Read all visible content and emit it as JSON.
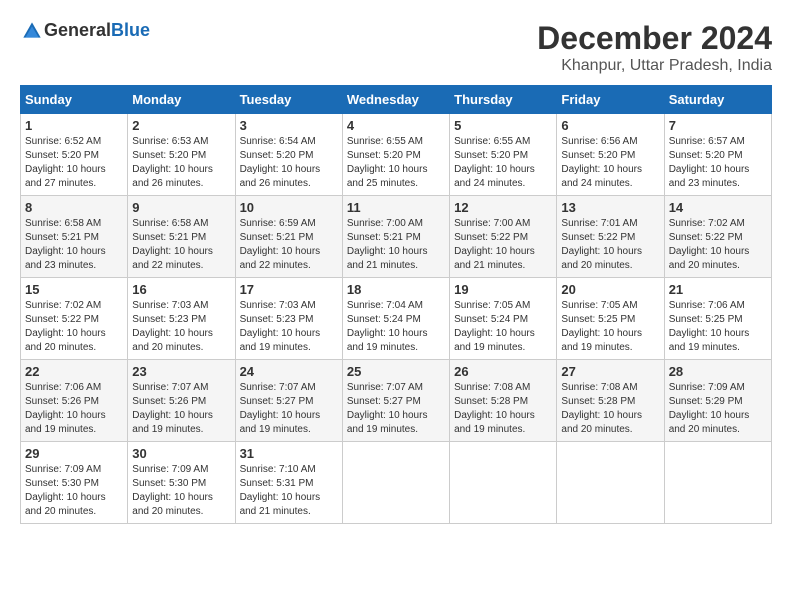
{
  "logo": {
    "text_general": "General",
    "text_blue": "Blue"
  },
  "title": "December 2024",
  "subtitle": "Khanpur, Uttar Pradesh, India",
  "days_of_week": [
    "Sunday",
    "Monday",
    "Tuesday",
    "Wednesday",
    "Thursday",
    "Friday",
    "Saturday"
  ],
  "weeks": [
    [
      {
        "day": "1",
        "info": "Sunrise: 6:52 AM\nSunset: 5:20 PM\nDaylight: 10 hours\nand 27 minutes."
      },
      {
        "day": "2",
        "info": "Sunrise: 6:53 AM\nSunset: 5:20 PM\nDaylight: 10 hours\nand 26 minutes."
      },
      {
        "day": "3",
        "info": "Sunrise: 6:54 AM\nSunset: 5:20 PM\nDaylight: 10 hours\nand 26 minutes."
      },
      {
        "day": "4",
        "info": "Sunrise: 6:55 AM\nSunset: 5:20 PM\nDaylight: 10 hours\nand 25 minutes."
      },
      {
        "day": "5",
        "info": "Sunrise: 6:55 AM\nSunset: 5:20 PM\nDaylight: 10 hours\nand 24 minutes."
      },
      {
        "day": "6",
        "info": "Sunrise: 6:56 AM\nSunset: 5:20 PM\nDaylight: 10 hours\nand 24 minutes."
      },
      {
        "day": "7",
        "info": "Sunrise: 6:57 AM\nSunset: 5:20 PM\nDaylight: 10 hours\nand 23 minutes."
      }
    ],
    [
      {
        "day": "8",
        "info": "Sunrise: 6:58 AM\nSunset: 5:21 PM\nDaylight: 10 hours\nand 23 minutes."
      },
      {
        "day": "9",
        "info": "Sunrise: 6:58 AM\nSunset: 5:21 PM\nDaylight: 10 hours\nand 22 minutes."
      },
      {
        "day": "10",
        "info": "Sunrise: 6:59 AM\nSunset: 5:21 PM\nDaylight: 10 hours\nand 22 minutes."
      },
      {
        "day": "11",
        "info": "Sunrise: 7:00 AM\nSunset: 5:21 PM\nDaylight: 10 hours\nand 21 minutes."
      },
      {
        "day": "12",
        "info": "Sunrise: 7:00 AM\nSunset: 5:22 PM\nDaylight: 10 hours\nand 21 minutes."
      },
      {
        "day": "13",
        "info": "Sunrise: 7:01 AM\nSunset: 5:22 PM\nDaylight: 10 hours\nand 20 minutes."
      },
      {
        "day": "14",
        "info": "Sunrise: 7:02 AM\nSunset: 5:22 PM\nDaylight: 10 hours\nand 20 minutes."
      }
    ],
    [
      {
        "day": "15",
        "info": "Sunrise: 7:02 AM\nSunset: 5:22 PM\nDaylight: 10 hours\nand 20 minutes."
      },
      {
        "day": "16",
        "info": "Sunrise: 7:03 AM\nSunset: 5:23 PM\nDaylight: 10 hours\nand 20 minutes."
      },
      {
        "day": "17",
        "info": "Sunrise: 7:03 AM\nSunset: 5:23 PM\nDaylight: 10 hours\nand 19 minutes."
      },
      {
        "day": "18",
        "info": "Sunrise: 7:04 AM\nSunset: 5:24 PM\nDaylight: 10 hours\nand 19 minutes."
      },
      {
        "day": "19",
        "info": "Sunrise: 7:05 AM\nSunset: 5:24 PM\nDaylight: 10 hours\nand 19 minutes."
      },
      {
        "day": "20",
        "info": "Sunrise: 7:05 AM\nSunset: 5:25 PM\nDaylight: 10 hours\nand 19 minutes."
      },
      {
        "day": "21",
        "info": "Sunrise: 7:06 AM\nSunset: 5:25 PM\nDaylight: 10 hours\nand 19 minutes."
      }
    ],
    [
      {
        "day": "22",
        "info": "Sunrise: 7:06 AM\nSunset: 5:26 PM\nDaylight: 10 hours\nand 19 minutes."
      },
      {
        "day": "23",
        "info": "Sunrise: 7:07 AM\nSunset: 5:26 PM\nDaylight: 10 hours\nand 19 minutes."
      },
      {
        "day": "24",
        "info": "Sunrise: 7:07 AM\nSunset: 5:27 PM\nDaylight: 10 hours\nand 19 minutes."
      },
      {
        "day": "25",
        "info": "Sunrise: 7:07 AM\nSunset: 5:27 PM\nDaylight: 10 hours\nand 19 minutes."
      },
      {
        "day": "26",
        "info": "Sunrise: 7:08 AM\nSunset: 5:28 PM\nDaylight: 10 hours\nand 19 minutes."
      },
      {
        "day": "27",
        "info": "Sunrise: 7:08 AM\nSunset: 5:28 PM\nDaylight: 10 hours\nand 20 minutes."
      },
      {
        "day": "28",
        "info": "Sunrise: 7:09 AM\nSunset: 5:29 PM\nDaylight: 10 hours\nand 20 minutes."
      }
    ],
    [
      {
        "day": "29",
        "info": "Sunrise: 7:09 AM\nSunset: 5:30 PM\nDaylight: 10 hours\nand 20 minutes."
      },
      {
        "day": "30",
        "info": "Sunrise: 7:09 AM\nSunset: 5:30 PM\nDaylight: 10 hours\nand 20 minutes."
      },
      {
        "day": "31",
        "info": "Sunrise: 7:10 AM\nSunset: 5:31 PM\nDaylight: 10 hours\nand 21 minutes."
      },
      {
        "day": "",
        "info": ""
      },
      {
        "day": "",
        "info": ""
      },
      {
        "day": "",
        "info": ""
      },
      {
        "day": "",
        "info": ""
      }
    ]
  ]
}
